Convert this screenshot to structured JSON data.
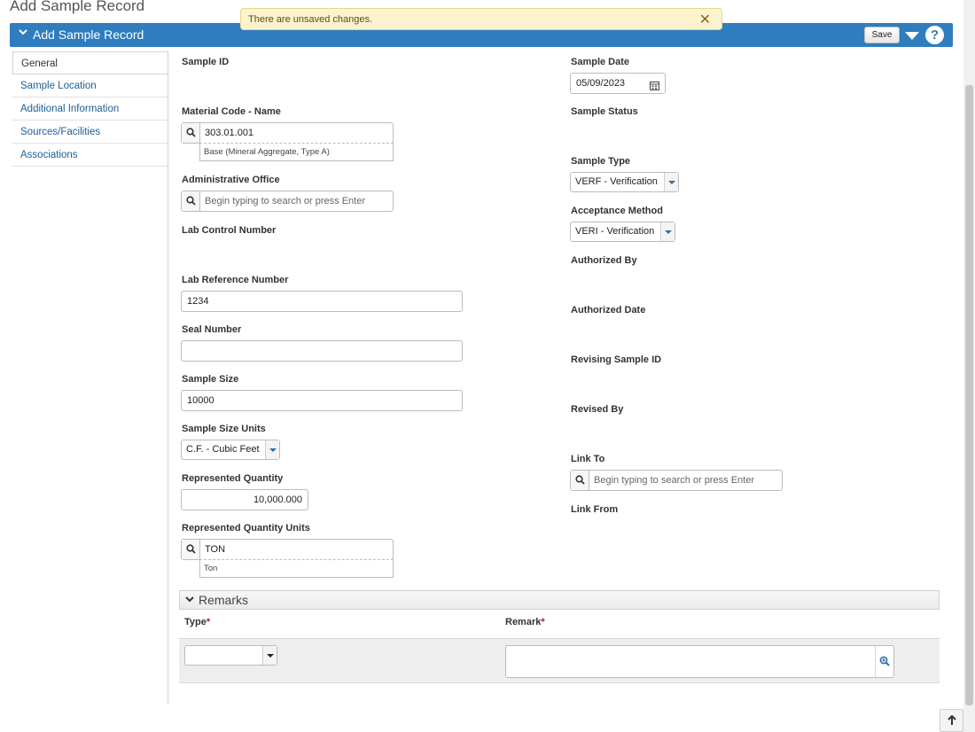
{
  "page": {
    "title": "Add Sample Record"
  },
  "alert": {
    "message": "There are unsaved changes.",
    "close_glyph": "✕"
  },
  "header": {
    "title": "Add Sample Record",
    "save_label": "Save",
    "help_glyph": "?"
  },
  "sidebar": {
    "items": [
      {
        "label": "General"
      },
      {
        "label": "Sample Location"
      },
      {
        "label": "Additional Information"
      },
      {
        "label": "Sources/Facilities"
      },
      {
        "label": "Associations"
      }
    ]
  },
  "form": {
    "sample_id": {
      "label": "Sample ID"
    },
    "material_code": {
      "label": "Material Code - Name",
      "value": "303.01.001",
      "description": "Base (Mineral Aggregate, Type A)"
    },
    "admin_office": {
      "label": "Administrative Office",
      "placeholder": "Begin typing to search or press Enter"
    },
    "lab_control_number": {
      "label": "Lab Control Number"
    },
    "lab_reference_number": {
      "label": "Lab Reference Number",
      "value": "1234"
    },
    "seal_number": {
      "label": "Seal Number",
      "value": ""
    },
    "sample_size": {
      "label": "Sample Size",
      "value": "10000"
    },
    "sample_size_units": {
      "label": "Sample Size Units",
      "value": "C.F. - Cubic Feet"
    },
    "represented_quantity": {
      "label": "Represented Quantity",
      "value": "10,000.000"
    },
    "represented_quantity_units": {
      "label": "Represented Quantity Units",
      "value": "TON",
      "description": "Ton"
    },
    "sample_date": {
      "label": "Sample Date",
      "value": "05/09/2023"
    },
    "sample_status": {
      "label": "Sample Status"
    },
    "sample_type": {
      "label": "Sample Type",
      "value": "VERF - Verification"
    },
    "acceptance_method": {
      "label": "Acceptance Method",
      "value": "VERI - Verification"
    },
    "authorized_by": {
      "label": "Authorized By"
    },
    "authorized_date": {
      "label": "Authorized Date"
    },
    "revising_sample_id": {
      "label": "Revising Sample ID"
    },
    "revised_by": {
      "label": "Revised By"
    },
    "link_to": {
      "label": "Link To",
      "placeholder": "Begin typing to search or press Enter"
    },
    "link_from": {
      "label": "Link From"
    }
  },
  "remarks": {
    "title": "Remarks",
    "type_header": "Type",
    "remark_header": "Remark",
    "required_marker": "*",
    "type_value": "",
    "remark_value": ""
  },
  "colors": {
    "header": "#2f7dbe",
    "alert_bg": "#fcf4cf",
    "link": "#1d5e96",
    "required": "#b31b1b"
  }
}
